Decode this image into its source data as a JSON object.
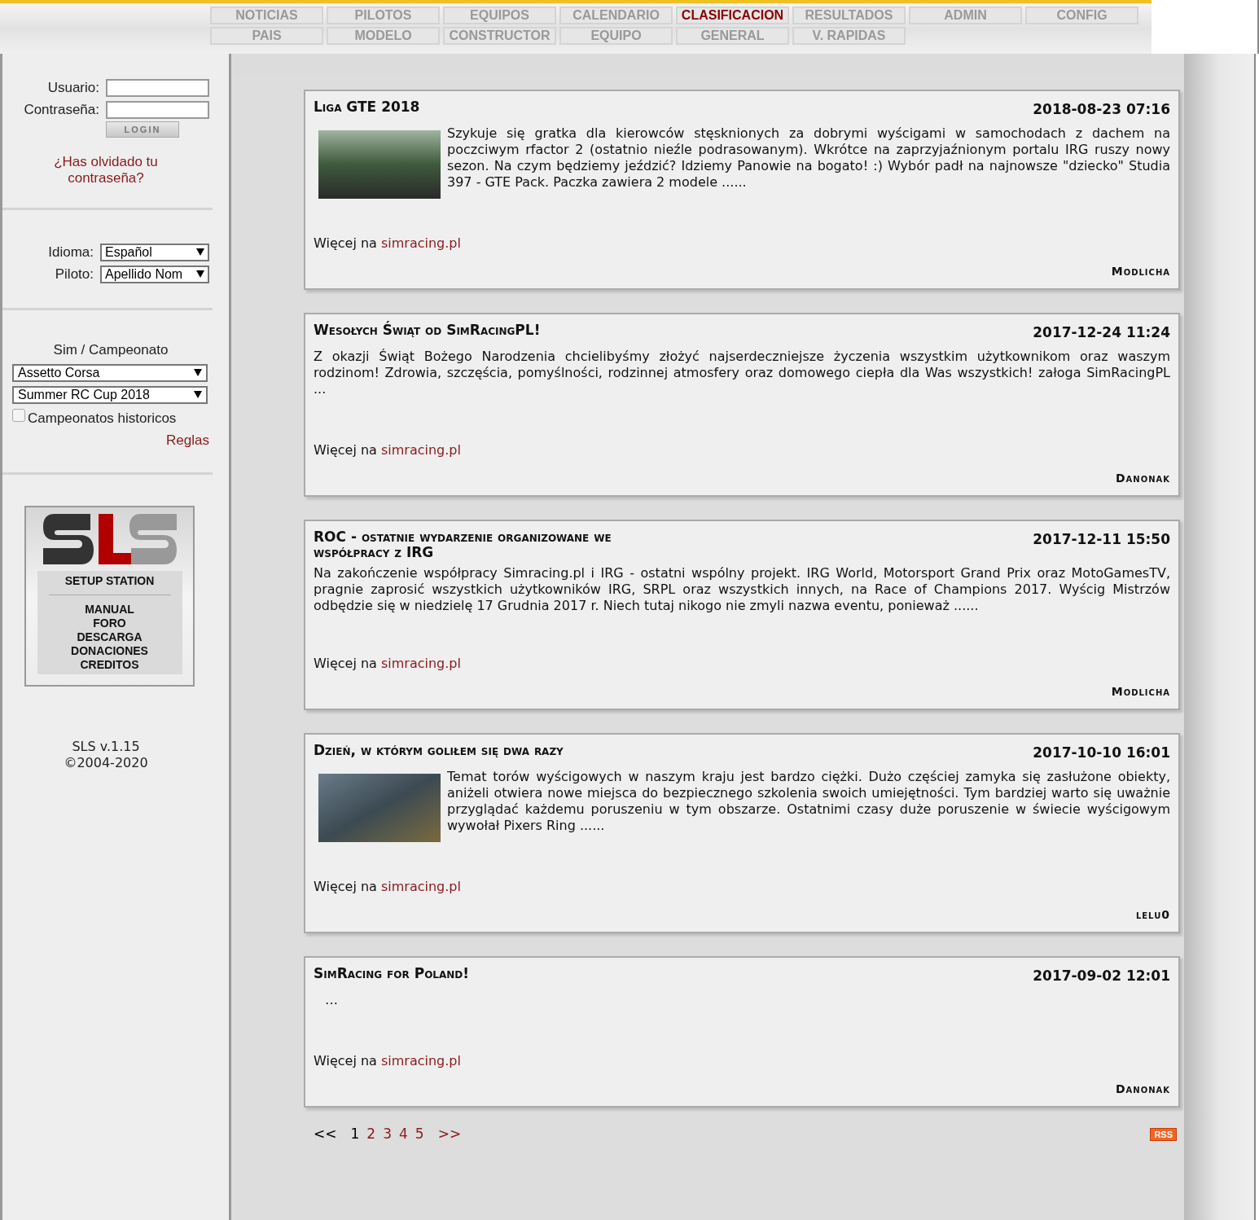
{
  "nav": {
    "rows": [
      [
        {
          "label": "NOTICIAS",
          "selected": false
        },
        {
          "label": "PILOTOS",
          "selected": false
        },
        {
          "label": "EQUIPOS",
          "selected": false
        },
        {
          "label": "CALENDARIO",
          "selected": false
        },
        {
          "label": "CLASIFICACION",
          "selected": true
        },
        {
          "label": "RESULTADOS",
          "selected": false
        },
        {
          "label": "ADMIN",
          "selected": false
        },
        {
          "label": "CONFIG",
          "selected": false
        }
      ],
      [
        {
          "label": "PAIS",
          "selected": false
        },
        {
          "label": "MODELO",
          "selected": false
        },
        {
          "label": "CONSTRUCTOR",
          "selected": false
        },
        {
          "label": "EQUIPO",
          "selected": false
        },
        {
          "label": "GENERAL",
          "selected": false
        },
        {
          "label": "V. RAPIDAS",
          "selected": false
        }
      ]
    ]
  },
  "sidebar": {
    "login": {
      "user_label": "Usuario:",
      "password_label": "Contraseña:",
      "button": "LOGIN",
      "forgot": "¿Has olvidado tu contraseña?"
    },
    "prefs": [
      {
        "label": "Idioma:",
        "value": "Español"
      },
      {
        "label": "Piloto:",
        "value": "Apellido Nom"
      }
    ],
    "championship": {
      "heading": "Sim / Campeonato",
      "selects": [
        "Assetto Corsa",
        "Summer RC Cup 2018"
      ],
      "historic": {
        "label": "Campeonatos historicos",
        "checked": false
      },
      "rules": "Reglas"
    },
    "sls": {
      "subtitle": "SETUP STATION",
      "links": [
        "MANUAL",
        "FORO",
        "DESCARGA",
        "DONACIONES",
        "CREDITOS"
      ]
    },
    "version": "SLS v.1.15",
    "copyright": "©2004-2020"
  },
  "articles": [
    {
      "title": "Liga GTE 2018",
      "date": "2018-08-23 07:16",
      "has_image": true,
      "body": "Szykuje się gratka dla kierowców stęsknionych za dobrymi wyścigami w samochodach z dachem na poczciwym rfactor 2 (ostatnio nieźle podrasowanym). Wkrótce na zaprzyjaźnionym portalu IRG ruszy nowy sezon. Na czym będziemy jeździć? Idziemy Panowie na bogato! :) Wybór padł na najnowsze \"dziecko\" Studia 397 - GTE Pack. Paczka zawiera 2 modele ......",
      "more": "Więcej na",
      "link": "simracing.pl",
      "author": "Modlicha"
    },
    {
      "title": "Wesołych Świąt od SimRacingPL!",
      "date": "2017-12-24 11:24",
      "has_image": false,
      "body": "Z okazji Świąt Bożego Narodzenia chcielibyśmy złożyć najserdeczniejsze życzenia wszystkim użytkownikom oraz waszym rodzinom! Zdrowia, szczęścia, pomyślności, rodzinnej atmosfery oraz domowego ciepła dla Was wszystkich! załoga SimRacingPL ...",
      "more": "Więcej na",
      "link": "simracing.pl",
      "author": "Danonak"
    },
    {
      "title": "ROC - ostatnie wydarzenie organizowane we współpracy z IRG",
      "date": "2017-12-11 15:50",
      "has_image": false,
      "body": "Na zakończenie współpracy Simracing.pl i IRG - ostatni wspólny projekt. IRG World, Motorsport Grand Prix oraz MotoGamesTV, pragnie zaprosić wszystkich użytkowników IRG, SRPL oraz wszystkich innych, na Race of Champions 2017. Wyścig Mistrzów odbędzie się w niedzielę 17 Grudnia 2017 r. Niech tutaj nikogo nie zmyli nazwa eventu, ponieważ ......",
      "more": "Więcej na",
      "link": "simracing.pl",
      "author": "Modlicha"
    },
    {
      "title": "Dzień, w którym goliłem się dwa razy",
      "date": "2017-10-10 16:01",
      "has_image": true,
      "body": "Temat torów wyścigowych w naszym kraju jest bardzo ciężki. Dużo częściej zamyka się zasłużone obiekty, aniżeli otwiera nowe miejsca do bezpiecznego szkolenia swoich umiejętności. Tym bardziej warto się uważnie przyglądać każdemu poruszeniu w tym obszarze. Ostatnimi czasy duże poruszenie w świecie wyścigowym wywołał Pixers Ring ......",
      "more": "Więcej na",
      "link": "simracing.pl",
      "author": "lelu0"
    },
    {
      "title": "SimRacing for Poland!",
      "date": "2017-09-02 12:01",
      "has_image": false,
      "body": "…",
      "more": "Więcej na",
      "link": "simracing.pl",
      "author": "Danonak"
    }
  ],
  "pagination": {
    "prev": "<<",
    "pages": [
      {
        "label": "1",
        "selected": true
      },
      {
        "label": "2",
        "selected": false
      },
      {
        "label": "3",
        "selected": false
      },
      {
        "label": "4",
        "selected": false
      },
      {
        "label": "5",
        "selected": false
      }
    ],
    "next": ">>"
  },
  "rss": "RSS"
}
